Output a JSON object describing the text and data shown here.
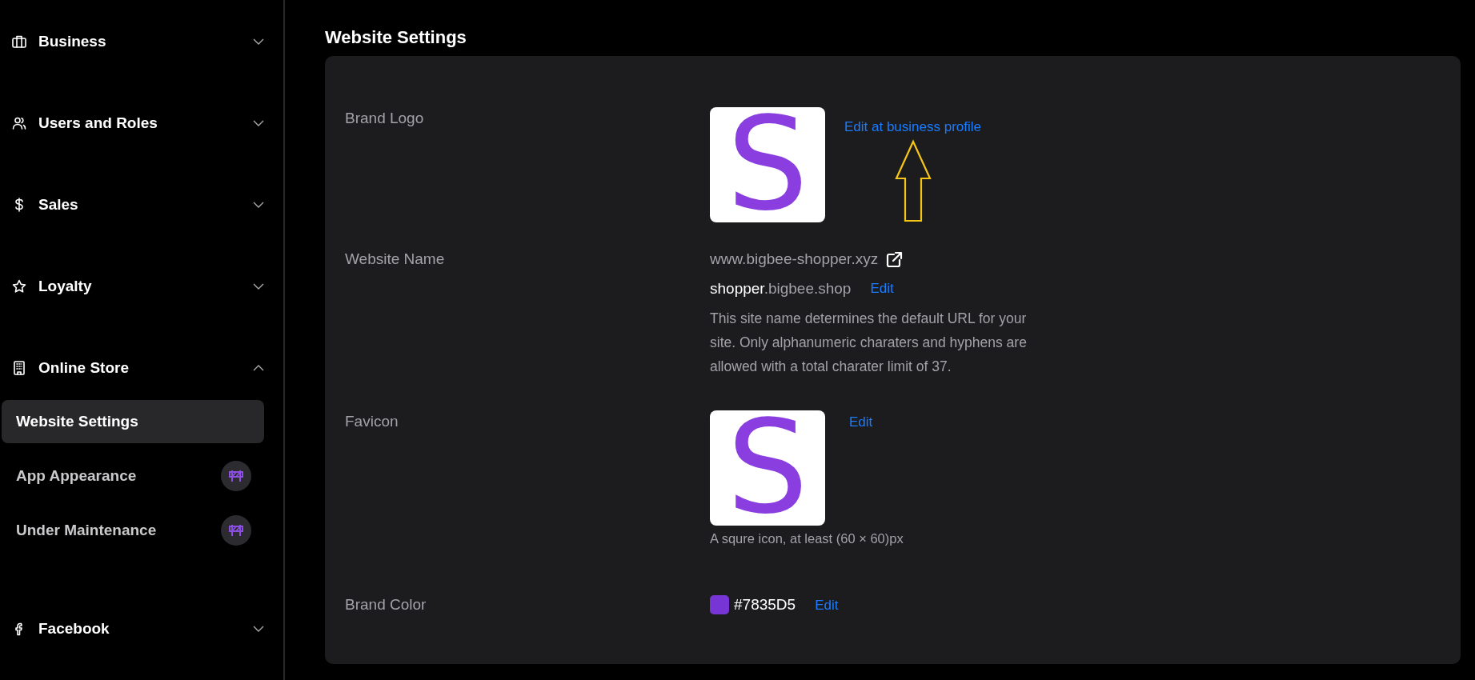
{
  "sidebar": {
    "groups": [
      {
        "label": "Business",
        "expanded": false
      },
      {
        "label": "Users and Roles",
        "expanded": false
      },
      {
        "label": "Sales",
        "expanded": false
      },
      {
        "label": "Loyalty",
        "expanded": false
      },
      {
        "label": "Online Store",
        "expanded": true,
        "children": [
          {
            "label": "Website Settings",
            "selected": true,
            "under_construction": false
          },
          {
            "label": "App Appearance",
            "selected": false,
            "under_construction": true
          },
          {
            "label": "Under Maintenance",
            "selected": false,
            "under_construction": true
          }
        ]
      },
      {
        "label": "Facebook",
        "expanded": false
      }
    ]
  },
  "page_title": "Website Settings",
  "settings": [
    {
      "kind": "logo",
      "label": "Brand Logo",
      "logo_text": "S",
      "link": "Edit at business profile"
    },
    {
      "kind": "website",
      "label": "Website Name",
      "url": "www.bigbee-shopper.xyz",
      "subdomain": "shopper",
      "domain": ".bigbee.shop",
      "link": "Edit",
      "description": "This site name determines the default URL for your site. Only alphanumeric charaters and hyphens are allowed with a total charater limit of 37."
    },
    {
      "kind": "favicon",
      "label": "Favicon",
      "logo_text": "S",
      "link": "Edit",
      "caption": "A squre icon, at least (60 × 60)px"
    },
    {
      "kind": "color",
      "label": "Brand Color",
      "color": "#7835d5",
      "value": "#7835D5",
      "link": "Edit"
    }
  ]
}
